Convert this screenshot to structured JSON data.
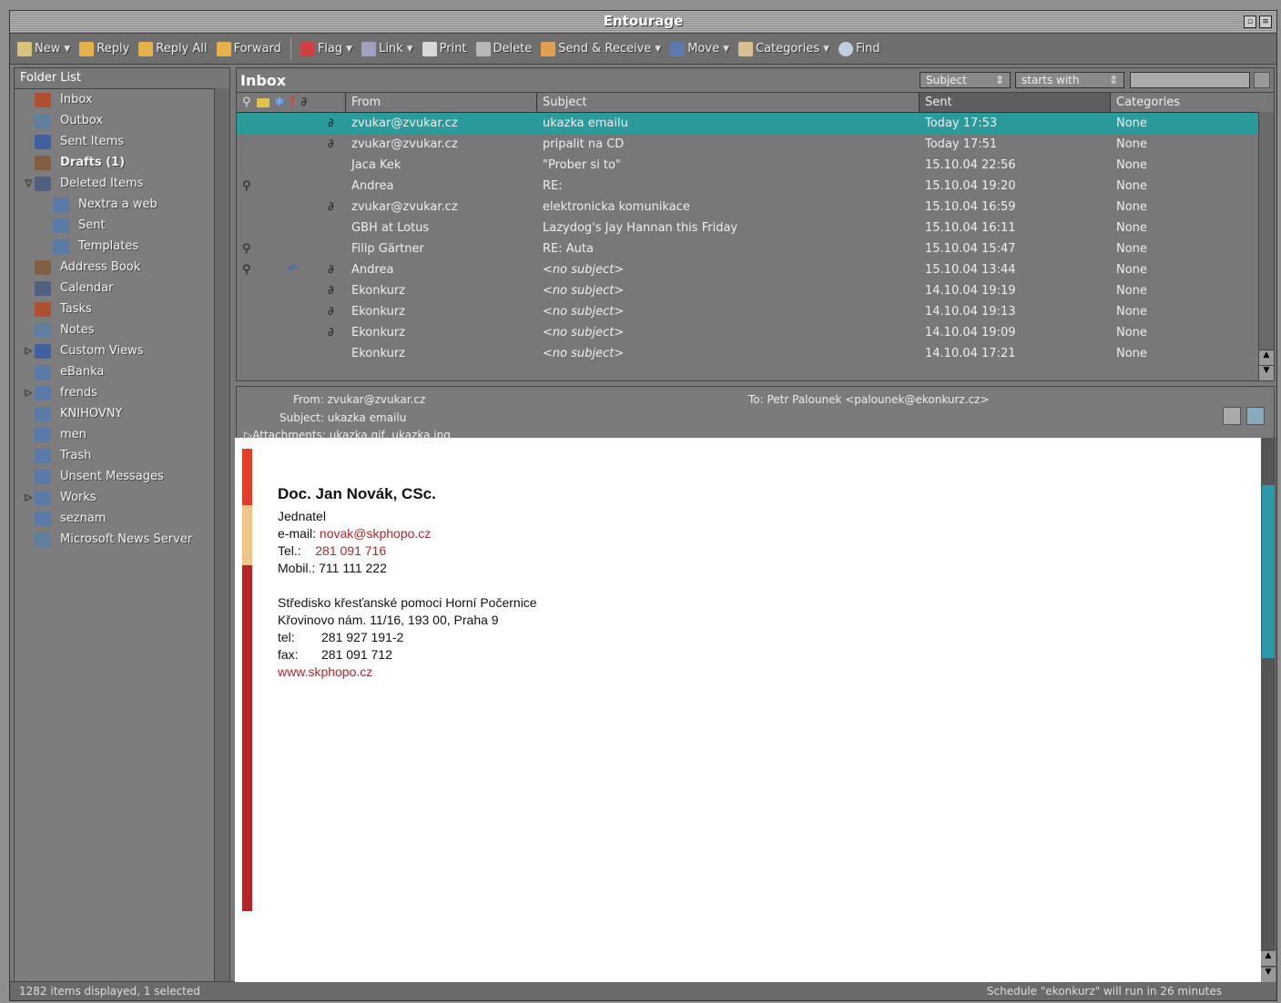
{
  "window": {
    "title": "Entourage"
  },
  "toolbar": {
    "new": "New",
    "reply": "Reply",
    "reply_all": "Reply All",
    "forward": "Forward",
    "flag": "Flag",
    "link": "Link",
    "print": "Print",
    "delete": "Delete",
    "send_receive": "Send & Receive",
    "move": "Move",
    "categories": "Categories",
    "find": "Find"
  },
  "folder_list": {
    "header": "Folder List",
    "items": [
      {
        "label": "Inbox",
        "icon": "inbox-icon"
      },
      {
        "label": "Outbox",
        "icon": "outbox-icon"
      },
      {
        "label": "Sent Items",
        "icon": "sent-icon"
      },
      {
        "label": "Drafts (1)",
        "icon": "drafts-icon"
      },
      {
        "label": "Deleted Items",
        "icon": "trash-icon"
      },
      {
        "label": "Nextra a web",
        "icon": "folder-icon"
      },
      {
        "label": "Sent",
        "icon": "folder-icon"
      },
      {
        "label": "Templates",
        "icon": "folder-icon"
      },
      {
        "label": "Address Book",
        "icon": "address-book-icon"
      },
      {
        "label": "Calendar",
        "icon": "calendar-icon"
      },
      {
        "label": "Tasks",
        "icon": "tasks-icon"
      },
      {
        "label": "Notes",
        "icon": "notes-icon"
      },
      {
        "label": "Custom Views",
        "icon": "custom-views-icon"
      },
      {
        "label": "eBanka",
        "icon": "folder-icon"
      },
      {
        "label": "frends",
        "icon": "folder-icon"
      },
      {
        "label": "KNIHOVNY",
        "icon": "folder-icon"
      },
      {
        "label": "men",
        "icon": "folder-icon"
      },
      {
        "label": "Trash",
        "icon": "folder-icon"
      },
      {
        "label": "Unsent Messages",
        "icon": "folder-icon"
      },
      {
        "label": "Works",
        "icon": "folder-icon"
      },
      {
        "label": "seznam",
        "icon": "folder-icon"
      },
      {
        "label": "Microsoft News Server",
        "icon": "news-server-icon"
      }
    ]
  },
  "inbox": {
    "title": "Inbox",
    "filter_field": "Subject",
    "filter_mode": "starts with",
    "columns": {
      "from": "From",
      "subject": "Subject",
      "sent": "Sent",
      "categories": "Categories"
    },
    "rows": [
      {
        "from": "zvukar@zvukar.cz",
        "subject": "ukazka emailu",
        "sent": "Today 17:53",
        "category": "None"
      },
      {
        "from": "zvukar@zvukar.cz",
        "subject": "pripalit na CD",
        "sent": "Today 17:51",
        "category": "None"
      },
      {
        "from": "Jaca Kek",
        "subject": "\"Prober si to\"",
        "sent": "15.10.04 22:56",
        "category": "None"
      },
      {
        "from": "Andrea",
        "subject": "RE:",
        "sent": "15.10.04 19:20",
        "category": "None"
      },
      {
        "from": "zvukar@zvukar.cz",
        "subject": "elektronicka komunikace",
        "sent": "15.10.04 16:59",
        "category": "None"
      },
      {
        "from": "GBH at Lotus",
        "subject": "Lazydog's Jay Hannan this Friday",
        "sent": "15.10.04 16:11",
        "category": "None"
      },
      {
        "from": "Filip Gärtner",
        "subject": "RE: Auta",
        "sent": "15.10.04 15:47",
        "category": "None"
      },
      {
        "from": "Andrea",
        "subject": "<no subject>",
        "sent": "15.10.04 13:44",
        "category": "None"
      },
      {
        "from": "Ekonkurz",
        "subject": "<no subject>",
        "sent": "14.10.04 19:19",
        "category": "None"
      },
      {
        "from": "Ekonkurz",
        "subject": "<no subject>",
        "sent": "14.10.04 19:13",
        "category": "None"
      },
      {
        "from": "Ekonkurz",
        "subject": "<no subject>",
        "sent": "14.10.04 19:09",
        "category": "None"
      },
      {
        "from": "Ekonkurz",
        "subject": "<no subject>",
        "sent": "14.10.04 17:21",
        "category": "None"
      }
    ]
  },
  "message": {
    "from": "From: zvukar@zvukar.cz",
    "to": "To: Petr Palounek <palounek@ekonkurz.cz>",
    "subject": "Subject: ukazka emailu",
    "attachments": "Attachments: ukazka.gif, ukazka.jpg",
    "signature": {
      "name": "Doc. Jan Novák, CSc.",
      "role": "Jednatel",
      "email_label": "e-mail: ",
      "email": "novak@skphopo.cz",
      "tel_label": "Tel.:",
      "tel": "281 091 716",
      "mobil": "Mobil.: 711 111 222",
      "org": "Středisko křesťanské pomoci Horní Počernice",
      "address": "Křovinovo nám. 11/16, 193 00, Praha 9",
      "tel2_label": "tel:",
      "tel2": "281 927 191-2",
      "fax_label": "fax:",
      "fax": "281 091 712",
      "web": "www.skphopo.cz"
    }
  },
  "status": {
    "left": "1282 items displayed, 1 selected",
    "right": "Schedule \"ekonkurz\" will run in 26 minutes"
  },
  "colors": {
    "selection": "#2b9a9a",
    "accent_red": "#b3262b",
    "accent_orange": "#e0402a",
    "accent_peach": "#f0c58a"
  }
}
